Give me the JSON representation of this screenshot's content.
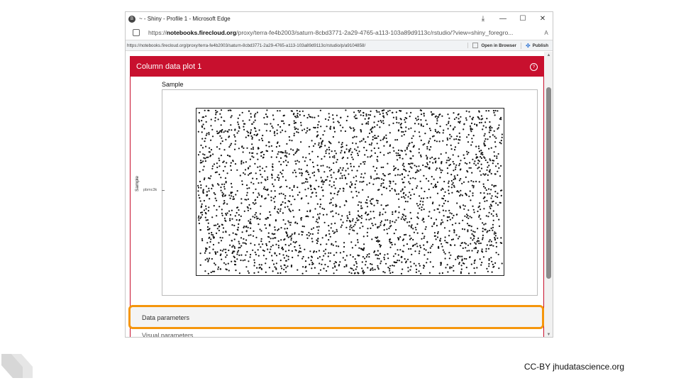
{
  "browser": {
    "title": "~ - Shiny - Profile 1 - Microsoft Edge",
    "profile_initial": "B",
    "url_prefix": "https://",
    "url_host": "notebooks.firecloud.org",
    "url_path": "/proxy/terra-fe4b2003/saturn-8cbd3771-2a29-4765-a113-103a89d9113c/rstudio/?view=shiny_foregro...",
    "reader_label": "A",
    "controls": [
      "⤓",
      "—",
      "☐",
      "✕"
    ]
  },
  "rstudio_bar": {
    "url": "https://notebooks.firecloud.org/proxy/terra-fe4b2003/saturn-8cbd3771-2a29-4765-a113-103a89d9113c/rstudio/p/a9104858/",
    "open_browser": "Open in Browser",
    "publish": "Publish"
  },
  "panel": {
    "title": "Column data plot 1",
    "help_icon": "?"
  },
  "chart_data": {
    "type": "scatter",
    "title": "Sample",
    "ylabel": "Sample",
    "xlabel": "",
    "y_categories": [
      "pbmc3k"
    ],
    "points": "jittered dense cloud of cells, all in category pbmc3k",
    "grid": true
  },
  "sections": {
    "data_parameters": "Data parameters",
    "visual_parameters": "Visual parameters"
  },
  "footer": "CC-BY  jhudatascience.org",
  "colors": {
    "accent": "#c8102e",
    "highlight": "#f5960c"
  }
}
